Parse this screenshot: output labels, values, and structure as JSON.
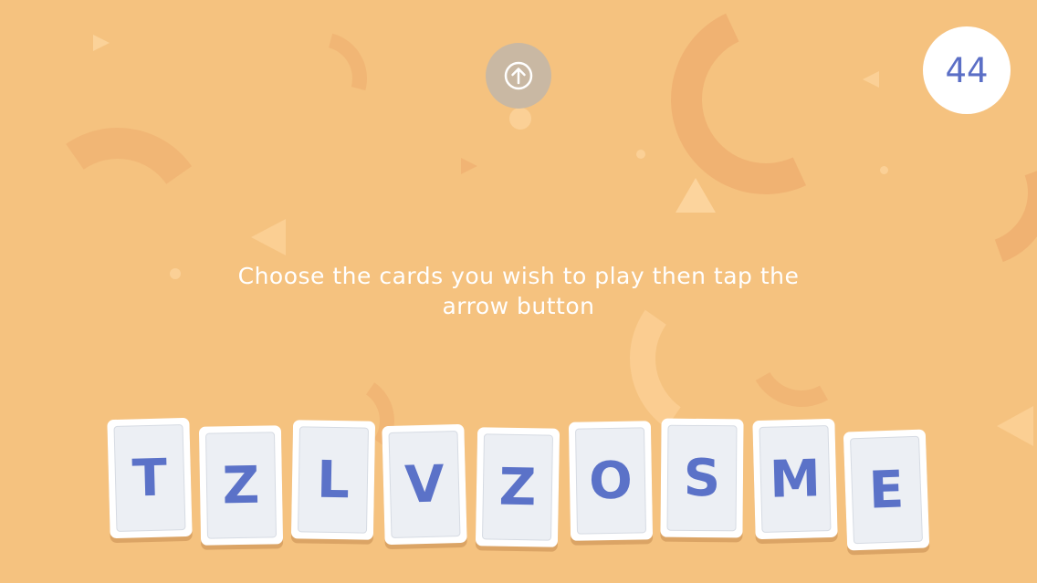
{
  "timer": {
    "value": "44"
  },
  "instruction": {
    "line1": "Choose the cards you wish to play then tap the",
    "line2": "arrow button"
  },
  "arrow_button": {
    "icon": "arrow-up-circle-icon"
  },
  "cards": [
    {
      "letter": "T"
    },
    {
      "letter": "Z"
    },
    {
      "letter": "L"
    },
    {
      "letter": "V"
    },
    {
      "letter": "Z"
    },
    {
      "letter": "O"
    },
    {
      "letter": "S"
    },
    {
      "letter": "M"
    },
    {
      "letter": "E"
    }
  ],
  "colors": {
    "background": "#f5c27f",
    "card_letter": "#5b72c8",
    "timer_text": "#5b6fc6"
  }
}
